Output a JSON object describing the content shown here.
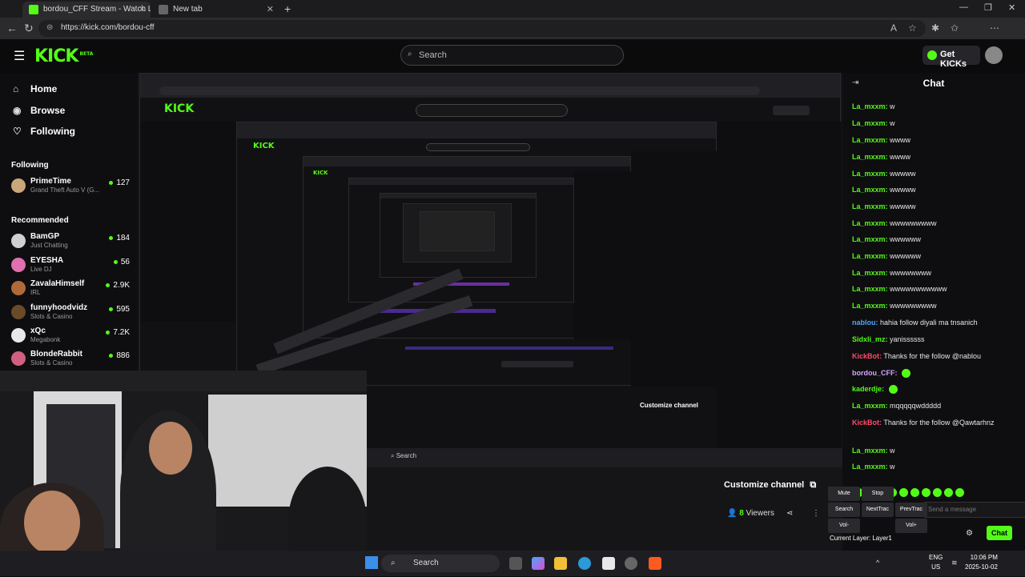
{
  "tabs": [
    {
      "label": "bordou_CFF Stream - Watch Live",
      "active": true
    },
    {
      "label": "New tab",
      "active": false
    }
  ],
  "url": "https://kick.com/bordou-cff",
  "header": {
    "search_placeholder": "Search",
    "get_kicks": "Get KICKs",
    "logo": "KICK",
    "logo_sup": "BETA"
  },
  "sidebar": {
    "nav": [
      {
        "label": "Home",
        "icon": "home-icon"
      },
      {
        "label": "Browse",
        "icon": "compass-icon"
      },
      {
        "label": "Following",
        "icon": "heart-icon"
      }
    ],
    "following_title": "Following",
    "following": [
      {
        "name": "PrimeTime",
        "category": "Grand Theft Auto V (G...",
        "viewers": "127",
        "color": "#c9a77a"
      }
    ],
    "recommended_title": "Recommended",
    "recommended": [
      {
        "name": "BamGP",
        "category": "Just Chatting",
        "viewers": "184",
        "color": "#d0d0d0"
      },
      {
        "name": "EYESHA",
        "category": "Live DJ",
        "viewers": "56",
        "color": "#e070b0"
      },
      {
        "name": "ZavalaHimself",
        "category": "IRL",
        "viewers": "2.9K",
        "color": "#b06a3a"
      },
      {
        "name": "funnyhoodvidz",
        "category": "Slots & Casino",
        "viewers": "595",
        "color": "#6b4a2a"
      },
      {
        "name": "xQc",
        "category": "Megabonk",
        "viewers": "7.2K",
        "color": "#e8e8e8"
      },
      {
        "name": "BlondeRabbit",
        "category": "Slots & Casino",
        "viewers": "886",
        "color": "#d06080"
      }
    ]
  },
  "chat": {
    "title": "Chat",
    "messages": [
      {
        "user": "La_mxxm:",
        "text": "w",
        "kind": "u"
      },
      {
        "user": "La_mxxm:",
        "text": "w",
        "kind": "u"
      },
      {
        "user": "La_mxxm:",
        "text": "wwww",
        "kind": "u"
      },
      {
        "user": "La_mxxm:",
        "text": "wwww",
        "kind": "u"
      },
      {
        "user": "La_mxxm:",
        "text": "wwwww",
        "kind": "u"
      },
      {
        "user": "La_mxxm:",
        "text": "wwwww",
        "kind": "u"
      },
      {
        "user": "La_mxxm:",
        "text": "wwwww",
        "kind": "u"
      },
      {
        "user": "La_mxxm:",
        "text": "wwwwwwwww",
        "kind": "u"
      },
      {
        "user": "La_mxxm:",
        "text": "wwwwww",
        "kind": "u"
      },
      {
        "user": "La_mxxm:",
        "text": "wwwwww",
        "kind": "u"
      },
      {
        "user": "La_mxxm:",
        "text": "wwwwwwww",
        "kind": "u"
      },
      {
        "user": "La_mxxm:",
        "text": "wwwwwwwwwww",
        "kind": "u"
      },
      {
        "user": "La_mxxm:",
        "text": "wwwwwwwww",
        "kind": "u"
      },
      {
        "user": "nablou:",
        "text": "hahia follow diyali ma tnsanich",
        "kind": "u2"
      },
      {
        "user": "Sidxli_mz:",
        "text": "yanissssss",
        "kind": "u"
      },
      {
        "user": "KickBot:",
        "text": "Thanks for the follow @nablou",
        "kind": "u3"
      },
      {
        "user": "bordou_CFF:",
        "text": "",
        "kind": "u4"
      },
      {
        "user": "kaderdje:",
        "text": "",
        "kind": "u"
      },
      {
        "user": "La_mxxm:",
        "text": "mqqqqqwddddd",
        "kind": "u"
      },
      {
        "user": "KickBot:",
        "text": "Thanks for the follow @Qawtarhnz",
        "kind": "u3"
      },
      {
        "user": "La_mxxm:",
        "text": "w",
        "kind": "u"
      },
      {
        "user": "La_mxxm:",
        "text": "w",
        "kind": "u"
      }
    ],
    "send_label": "Chat",
    "input_placeholder": "Send a message"
  },
  "stream": {
    "customize_label": "Customize channel",
    "viewers_count": "8",
    "viewers_label": "Viewers",
    "media_controls": [
      "Mute",
      "Stop",
      "Search",
      "NextTrac",
      "PrevTrac",
      "Vol-",
      "Vol+"
    ],
    "current_layer": "Current Layer:  Layer1"
  },
  "taskbar": {
    "search_label": "Search",
    "lang_top": "ENG",
    "lang_bottom": "US",
    "time": "10:06 PM",
    "date": "2025-10-02"
  },
  "colors": {
    "accent": "#53fc18",
    "background": "#0b0b0c"
  }
}
